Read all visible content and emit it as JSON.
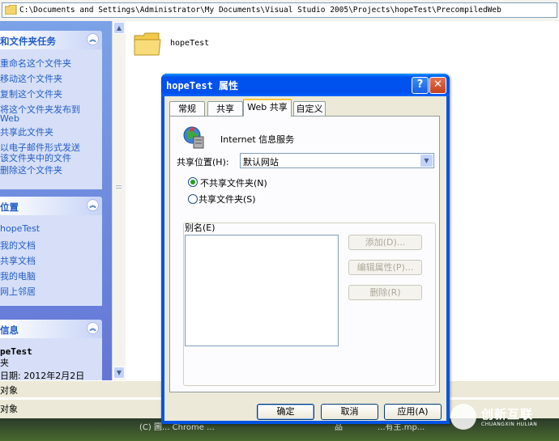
{
  "address": {
    "path": "C:\\Documents and Settings\\Administrator\\My Documents\\Visual Studio 2005\\Projects\\hopeTest\\PrecompiledWeb"
  },
  "tasks_panel": {
    "title": "和文件夹任务",
    "items": [
      "重命名这个文件夹",
      "移动这个文件夹",
      "复制这个文件夹",
      "将这个文件夹发布到",
      "Web",
      "共享此文件夹",
      "以电子邮件形式发送",
      "该文件夹中的文件",
      "删除这个文件夹"
    ]
  },
  "places_panel": {
    "title": "位置",
    "items": [
      "hopeTest",
      "我的文档",
      "共享文档",
      "我的电脑",
      "网上邻居"
    ]
  },
  "details_panel": {
    "title": "信息",
    "name": "peTest",
    "type": "夹",
    "date": "日期: 2012年2月2日"
  },
  "content": {
    "folder_name": "hopeTest"
  },
  "status": {
    "line1": "对象",
    "line2": "对象"
  },
  "desktop_text": {
    "left": "(C) 圖... Chrome ...",
    "mid": "品",
    "right": "...有主.mp..."
  },
  "dialog": {
    "title": "hopeTest 属性",
    "help_label": "?",
    "close_label": "✕",
    "tabs": [
      "常规",
      "共享",
      "Web 共享",
      "自定义"
    ],
    "active_tab": "Web 共享",
    "service_label": "Internet 信息服务",
    "share_location_label": "共享位置(H):",
    "share_location_value": "默认网站",
    "radio_no_share": "不共享文件夹(N)",
    "radio_share": "共享文件夹(S)",
    "alias_label": "别名(E)",
    "alias_items": [],
    "buttons_side": [
      "添加(D)...",
      "编辑属性(P)...",
      "删除(R)"
    ],
    "ok": "确定",
    "cancel": "取消",
    "apply": "应用(A)"
  },
  "watermark": {
    "text": "创新互联",
    "sub": "CHUANGXIN HULIAN"
  }
}
